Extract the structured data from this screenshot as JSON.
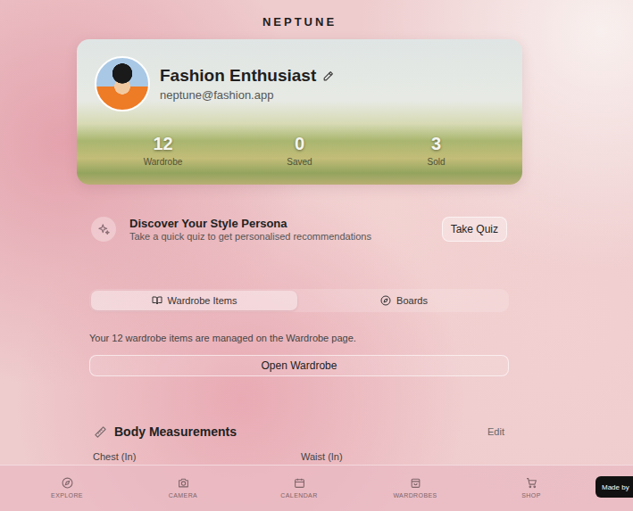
{
  "app": {
    "title": "NEPTUNE"
  },
  "profile": {
    "name": "Fashion Enthusiast",
    "email": "neptune@fashion.app",
    "stats": [
      {
        "value": "12",
        "label": "Wardrobe"
      },
      {
        "value": "0",
        "label": "Saved"
      },
      {
        "value": "3",
        "label": "Sold"
      }
    ]
  },
  "persona": {
    "title": "Discover Your Style Persona",
    "subtitle": "Take a quick quiz to get personalised recommendations",
    "button": "Take Quiz"
  },
  "tabs": [
    {
      "label": "Wardrobe Items",
      "selected": true
    },
    {
      "label": "Boards",
      "selected": false
    }
  ],
  "wardrobe": {
    "message": "Your 12 wardrobe items are managed on the Wardrobe page.",
    "button": "Open Wardrobe"
  },
  "measurements": {
    "title": "Body Measurements",
    "edit": "Edit",
    "fields": [
      "Chest (In)",
      "Waist (In)"
    ]
  },
  "nav": [
    {
      "label": "EXPLORE",
      "selected": false
    },
    {
      "label": "CAMERA",
      "selected": false
    },
    {
      "label": "CALENDAR",
      "selected": false
    },
    {
      "label": "WARDROBES",
      "selected": false
    },
    {
      "label": "SHOP",
      "selected": false
    }
  ],
  "badge": {
    "text": "Made by"
  }
}
